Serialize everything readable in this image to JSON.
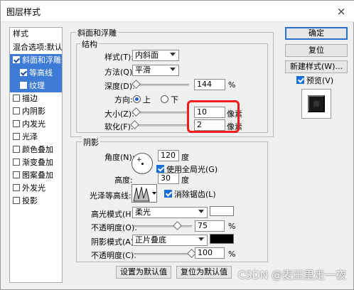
{
  "window": {
    "title": "图层样式",
    "close_glyph": "×"
  },
  "left_list": {
    "header": "样式",
    "items": [
      {
        "label": "混合选项:默认",
        "checkbox": false,
        "selected": false,
        "sub": false
      },
      {
        "label": "斜面和浮雕",
        "checkbox": true,
        "checked": true,
        "selected": true,
        "sub": false
      },
      {
        "label": "等高线",
        "checkbox": true,
        "checked": true,
        "selected": true,
        "sub": true
      },
      {
        "label": "纹理",
        "checkbox": true,
        "checked": false,
        "selected": true,
        "sub": true
      },
      {
        "label": "描边",
        "checkbox": true,
        "checked": false,
        "selected": false,
        "sub": false
      },
      {
        "label": "内阴影",
        "checkbox": true,
        "checked": false,
        "selected": false,
        "sub": false
      },
      {
        "label": "内发光",
        "checkbox": true,
        "checked": false,
        "selected": false,
        "sub": false
      },
      {
        "label": "光泽",
        "checkbox": true,
        "checked": false,
        "selected": false,
        "sub": false
      },
      {
        "label": "颜色叠加",
        "checkbox": true,
        "checked": false,
        "selected": false,
        "sub": false
      },
      {
        "label": "渐变叠加",
        "checkbox": true,
        "checked": false,
        "selected": false,
        "sub": false
      },
      {
        "label": "图案叠加",
        "checkbox": true,
        "checked": false,
        "selected": false,
        "sub": false
      },
      {
        "label": "外发光",
        "checkbox": true,
        "checked": false,
        "selected": false,
        "sub": false
      },
      {
        "label": "投影",
        "checkbox": true,
        "checked": false,
        "selected": false,
        "sub": false
      }
    ]
  },
  "bevel": {
    "group_title": "斜面和浮雕",
    "structure_title": "结构",
    "style_label": "样式(T):",
    "style_value": "内斜面",
    "technique_label": "方法(Q):",
    "technique_value": "平滑",
    "depth_label": "深度(D):",
    "depth_value": "144",
    "depth_unit": "%",
    "depth_slider_pct": 0.05,
    "direction_label": "方向:",
    "direction_up": "上",
    "direction_down": "下",
    "size_label": "大小(Z):",
    "size_value": "10",
    "size_unit": "像素",
    "size_slider_pct": 0.05,
    "soften_label": "软化(F):",
    "soften_value": "2",
    "soften_unit": "像素",
    "soften_slider_pct": 0.02
  },
  "shading": {
    "title": "阴影",
    "angle_label": "角度(N):",
    "angle_value": "120",
    "angle_unit": "度",
    "global_light_label": "使用全局光(G)",
    "altitude_label": "高度:",
    "altitude_value": "30",
    "altitude_unit": "度",
    "gloss_contour_label": "光泽等高线:",
    "antialiased_label": "消除锯齿(L)",
    "highlight_mode_label": "高光模式(H):",
    "highlight_mode_value": "柔光",
    "highlight_color": "#ffffff",
    "highlight_opacity_label": "不透明度(O):",
    "highlight_opacity_value": "75",
    "highlight_opacity_unit": "%",
    "highlight_opacity_pct": 0.75,
    "shadow_mode_label": "阴影模式(A):",
    "shadow_mode_value": "正片叠底",
    "shadow_color": "#000000",
    "shadow_opacity_label": "不透明度(C):",
    "shadow_opacity_value": "100",
    "shadow_opacity_unit": "%",
    "shadow_opacity_pct": 1.0
  },
  "bottom_buttons": {
    "set_default": "设置为默认值",
    "reset_default": "复位为默认值"
  },
  "right_buttons": {
    "ok": "确定",
    "reset": "复位",
    "new_style": "新建样式(W)...",
    "preview": "预览(V)"
  },
  "watermark": "CSDN @麦田里走一夜",
  "colors": {
    "selection": "#3d7bd6",
    "highlight_frame": "#ee1c1c",
    "default_button_border": "#2a70d0"
  }
}
